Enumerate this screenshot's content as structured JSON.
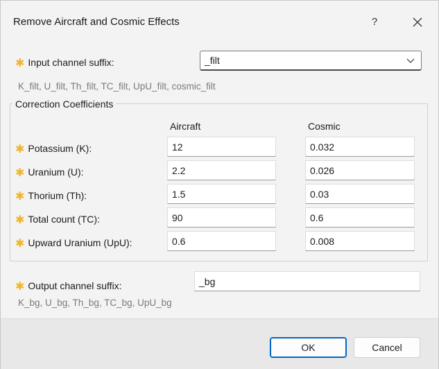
{
  "window": {
    "title": "Remove Aircraft and Cosmic Effects",
    "help_label": "?"
  },
  "input": {
    "label": "Input channel suffix:",
    "value": "_filt",
    "hint": "K_filt, U_filt, Th_filt, TC_filt, UpU_filt, cosmic_filt"
  },
  "coefficients": {
    "group_title": "Correction Coefficients",
    "col_aircraft": "Aircraft",
    "col_cosmic": "Cosmic",
    "rows": [
      {
        "label": "Potassium (K):",
        "aircraft": "12",
        "cosmic": "0.032"
      },
      {
        "label": "Uranium (U):",
        "aircraft": "2.2",
        "cosmic": "0.026"
      },
      {
        "label": "Thorium (Th):",
        "aircraft": "1.5",
        "cosmic": "0.03"
      },
      {
        "label": "Total count (TC):",
        "aircraft": "90",
        "cosmic": "0.6"
      },
      {
        "label": "Upward Uranium (UpU):",
        "aircraft": "0.6",
        "cosmic": "0.008"
      }
    ]
  },
  "output": {
    "label": "Output channel suffix:",
    "value": "_bg",
    "hint": "K_bg, U_bg, Th_bg, TC_bg, UpU_bg"
  },
  "buttons": {
    "ok": "OK",
    "cancel": "Cancel"
  },
  "colors": {
    "required_star": "#f0b429",
    "accent": "#0067c0"
  }
}
